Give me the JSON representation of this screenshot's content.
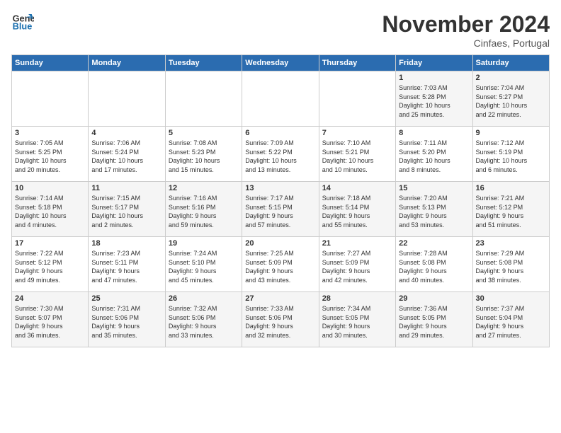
{
  "logo": {
    "line1": "General",
    "line2": "Blue"
  },
  "title": "November 2024",
  "subtitle": "Cinfaes, Portugal",
  "days_header": [
    "Sunday",
    "Monday",
    "Tuesday",
    "Wednesday",
    "Thursday",
    "Friday",
    "Saturday"
  ],
  "weeks": [
    [
      {
        "num": "",
        "info": ""
      },
      {
        "num": "",
        "info": ""
      },
      {
        "num": "",
        "info": ""
      },
      {
        "num": "",
        "info": ""
      },
      {
        "num": "",
        "info": ""
      },
      {
        "num": "1",
        "info": "Sunrise: 7:03 AM\nSunset: 5:28 PM\nDaylight: 10 hours\nand 25 minutes."
      },
      {
        "num": "2",
        "info": "Sunrise: 7:04 AM\nSunset: 5:27 PM\nDaylight: 10 hours\nand 22 minutes."
      }
    ],
    [
      {
        "num": "3",
        "info": "Sunrise: 7:05 AM\nSunset: 5:25 PM\nDaylight: 10 hours\nand 20 minutes."
      },
      {
        "num": "4",
        "info": "Sunrise: 7:06 AM\nSunset: 5:24 PM\nDaylight: 10 hours\nand 17 minutes."
      },
      {
        "num": "5",
        "info": "Sunrise: 7:08 AM\nSunset: 5:23 PM\nDaylight: 10 hours\nand 15 minutes."
      },
      {
        "num": "6",
        "info": "Sunrise: 7:09 AM\nSunset: 5:22 PM\nDaylight: 10 hours\nand 13 minutes."
      },
      {
        "num": "7",
        "info": "Sunrise: 7:10 AM\nSunset: 5:21 PM\nDaylight: 10 hours\nand 10 minutes."
      },
      {
        "num": "8",
        "info": "Sunrise: 7:11 AM\nSunset: 5:20 PM\nDaylight: 10 hours\nand 8 minutes."
      },
      {
        "num": "9",
        "info": "Sunrise: 7:12 AM\nSunset: 5:19 PM\nDaylight: 10 hours\nand 6 minutes."
      }
    ],
    [
      {
        "num": "10",
        "info": "Sunrise: 7:14 AM\nSunset: 5:18 PM\nDaylight: 10 hours\nand 4 minutes."
      },
      {
        "num": "11",
        "info": "Sunrise: 7:15 AM\nSunset: 5:17 PM\nDaylight: 10 hours\nand 2 minutes."
      },
      {
        "num": "12",
        "info": "Sunrise: 7:16 AM\nSunset: 5:16 PM\nDaylight: 9 hours\nand 59 minutes."
      },
      {
        "num": "13",
        "info": "Sunrise: 7:17 AM\nSunset: 5:15 PM\nDaylight: 9 hours\nand 57 minutes."
      },
      {
        "num": "14",
        "info": "Sunrise: 7:18 AM\nSunset: 5:14 PM\nDaylight: 9 hours\nand 55 minutes."
      },
      {
        "num": "15",
        "info": "Sunrise: 7:20 AM\nSunset: 5:13 PM\nDaylight: 9 hours\nand 53 minutes."
      },
      {
        "num": "16",
        "info": "Sunrise: 7:21 AM\nSunset: 5:12 PM\nDaylight: 9 hours\nand 51 minutes."
      }
    ],
    [
      {
        "num": "17",
        "info": "Sunrise: 7:22 AM\nSunset: 5:12 PM\nDaylight: 9 hours\nand 49 minutes."
      },
      {
        "num": "18",
        "info": "Sunrise: 7:23 AM\nSunset: 5:11 PM\nDaylight: 9 hours\nand 47 minutes."
      },
      {
        "num": "19",
        "info": "Sunrise: 7:24 AM\nSunset: 5:10 PM\nDaylight: 9 hours\nand 45 minutes."
      },
      {
        "num": "20",
        "info": "Sunrise: 7:25 AM\nSunset: 5:09 PM\nDaylight: 9 hours\nand 43 minutes."
      },
      {
        "num": "21",
        "info": "Sunrise: 7:27 AM\nSunset: 5:09 PM\nDaylight: 9 hours\nand 42 minutes."
      },
      {
        "num": "22",
        "info": "Sunrise: 7:28 AM\nSunset: 5:08 PM\nDaylight: 9 hours\nand 40 minutes."
      },
      {
        "num": "23",
        "info": "Sunrise: 7:29 AM\nSunset: 5:08 PM\nDaylight: 9 hours\nand 38 minutes."
      }
    ],
    [
      {
        "num": "24",
        "info": "Sunrise: 7:30 AM\nSunset: 5:07 PM\nDaylight: 9 hours\nand 36 minutes."
      },
      {
        "num": "25",
        "info": "Sunrise: 7:31 AM\nSunset: 5:06 PM\nDaylight: 9 hours\nand 35 minutes."
      },
      {
        "num": "26",
        "info": "Sunrise: 7:32 AM\nSunset: 5:06 PM\nDaylight: 9 hours\nand 33 minutes."
      },
      {
        "num": "27",
        "info": "Sunrise: 7:33 AM\nSunset: 5:06 PM\nDaylight: 9 hours\nand 32 minutes."
      },
      {
        "num": "28",
        "info": "Sunrise: 7:34 AM\nSunset: 5:05 PM\nDaylight: 9 hours\nand 30 minutes."
      },
      {
        "num": "29",
        "info": "Sunrise: 7:36 AM\nSunset: 5:05 PM\nDaylight: 9 hours\nand 29 minutes."
      },
      {
        "num": "30",
        "info": "Sunrise: 7:37 AM\nSunset: 5:04 PM\nDaylight: 9 hours\nand 27 minutes."
      }
    ]
  ]
}
